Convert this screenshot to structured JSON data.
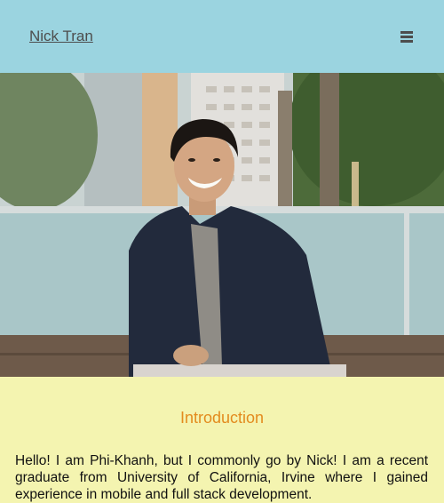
{
  "header": {
    "site_name": "Nick Tran",
    "menu_icon": "hamburger-menu-icon",
    "background": "#9bd4e0"
  },
  "hero": {
    "image": "portrait-photo"
  },
  "intro": {
    "heading": "Introduction",
    "body": "Hello! I am Phi-Khanh, but I commonly go by Nick! I am a recent graduate from University of California, Irvine where I gained experience in mobile and full stack development.",
    "heading_color": "#e38b1e",
    "background": "#f4f4b0"
  }
}
